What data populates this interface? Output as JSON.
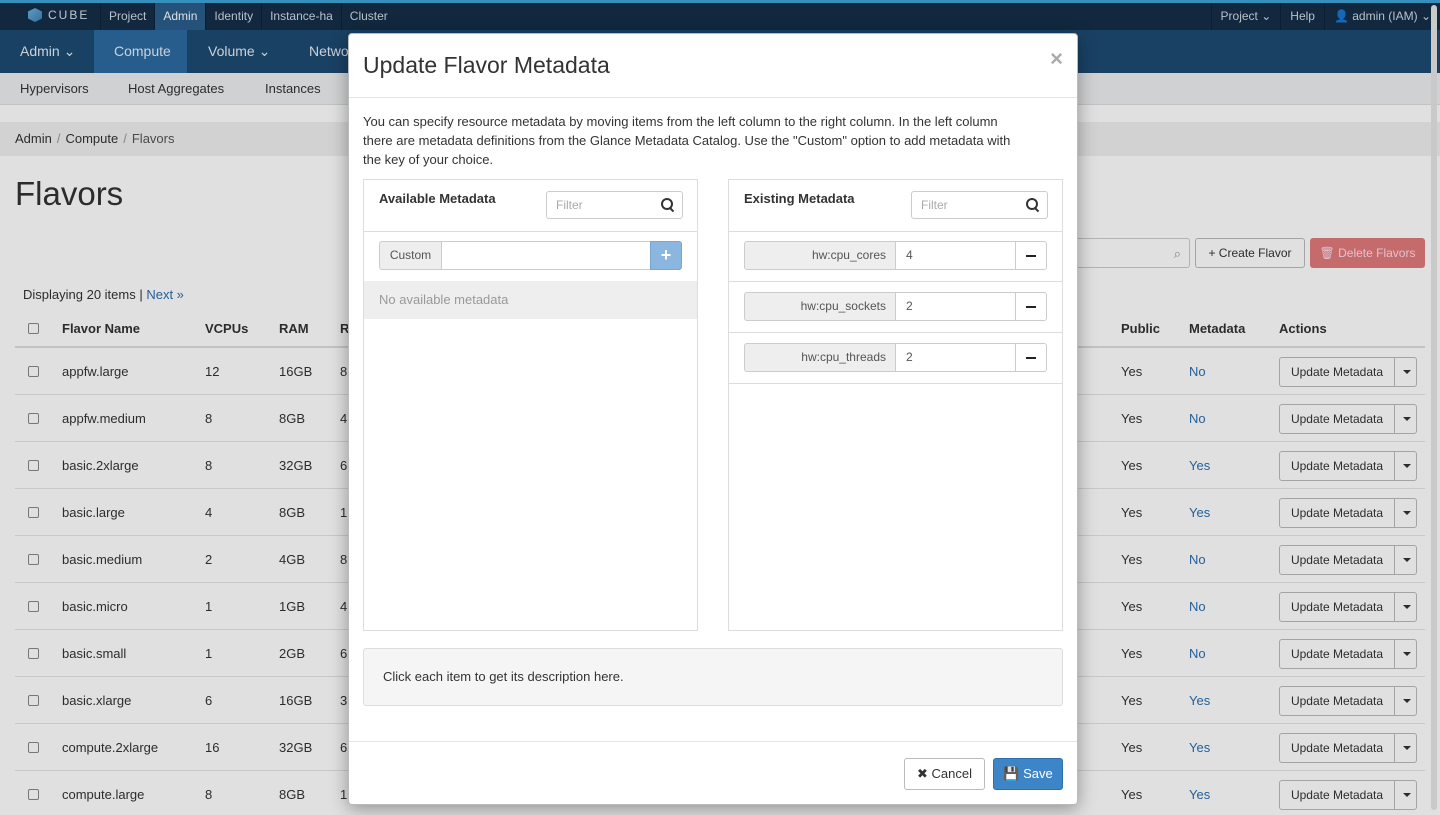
{
  "topbar": {
    "brand": "CUBE",
    "nav": [
      "Project",
      "Admin",
      "Identity",
      "Instance-ha",
      "Cluster"
    ],
    "active": "Admin",
    "right": [
      "Project ⌄",
      "Help",
      "👤 admin (IAM) ⌄"
    ]
  },
  "navbar": {
    "items": [
      "Admin ⌄",
      "Compute",
      "Volume ⌄",
      "Networ"
    ],
    "active": "Compute"
  },
  "subnav": {
    "items": [
      "Hypervisors",
      "Host Aggregates",
      "Instances"
    ]
  },
  "breadcrumb": {
    "items": [
      "Admin",
      "Compute",
      "Flavors"
    ],
    "separator": "/"
  },
  "page_title": "Flavors",
  "table_actions": {
    "create_label": "+ Create Flavor",
    "delete_label": "🗑 Delete Flavors"
  },
  "display": {
    "text": "Displaying 20 items | ",
    "next": "Next »"
  },
  "table": {
    "headers": [
      "Flavor Name",
      "VCPUs",
      "RAM",
      "R",
      "Public",
      "Metadata",
      "Actions"
    ],
    "rows": [
      {
        "name": "appfw.large",
        "vcpus": "12",
        "ram": "16GB",
        "root": "8",
        "public": "Yes",
        "metadata": "No"
      },
      {
        "name": "appfw.medium",
        "vcpus": "8",
        "ram": "8GB",
        "root": "4",
        "public": "Yes",
        "metadata": "No"
      },
      {
        "name": "basic.2xlarge",
        "vcpus": "8",
        "ram": "32GB",
        "root": "6",
        "public": "Yes",
        "metadata": "Yes"
      },
      {
        "name": "basic.large",
        "vcpus": "4",
        "ram": "8GB",
        "root": "1",
        "public": "Yes",
        "metadata": "Yes"
      },
      {
        "name": "basic.medium",
        "vcpus": "2",
        "ram": "4GB",
        "root": "8",
        "public": "Yes",
        "metadata": "No"
      },
      {
        "name": "basic.micro",
        "vcpus": "1",
        "ram": "1GB",
        "root": "4",
        "public": "Yes",
        "metadata": "No"
      },
      {
        "name": "basic.small",
        "vcpus": "1",
        "ram": "2GB",
        "root": "6",
        "public": "Yes",
        "metadata": "No"
      },
      {
        "name": "basic.xlarge",
        "vcpus": "6",
        "ram": "16GB",
        "root": "3",
        "public": "Yes",
        "metadata": "Yes"
      },
      {
        "name": "compute.2xlarge",
        "vcpus": "16",
        "ram": "32GB",
        "root": "6",
        "public": "Yes",
        "metadata": "Yes"
      },
      {
        "name": "compute.large",
        "vcpus": "8",
        "ram": "8GB",
        "root": "1",
        "public": "Yes",
        "metadata": "Yes"
      }
    ],
    "action_label": "Update Metadata"
  },
  "modal": {
    "title": "Update Flavor Metadata",
    "close": "×",
    "description": "You can specify resource metadata by moving items from the left column to the right column. In the left column there are metadata definitions from the Glance Metadata Catalog. Use the \"Custom\" option to add metadata with the key of your choice.",
    "available": {
      "title": "Available Metadata",
      "filter_placeholder": "Filter",
      "custom_label": "Custom",
      "add_symbol": "+",
      "empty_text": "No available metadata"
    },
    "existing": {
      "title": "Existing Metadata",
      "filter_placeholder": "Filter",
      "items": [
        {
          "key": "hw:cpu_cores",
          "value": "4"
        },
        {
          "key": "hw:cpu_sockets",
          "value": "2"
        },
        {
          "key": "hw:cpu_threads",
          "value": "2"
        }
      ]
    },
    "item_description": "Click each item to get its description here.",
    "cancel_label": "✖ Cancel",
    "save_label": "💾 Save"
  },
  "colors": {
    "topbar": "#142e47",
    "navbar": "#1d4a72",
    "link": "#2a6eb0",
    "primary": "#3d85c6",
    "danger": "#e27a7a"
  }
}
